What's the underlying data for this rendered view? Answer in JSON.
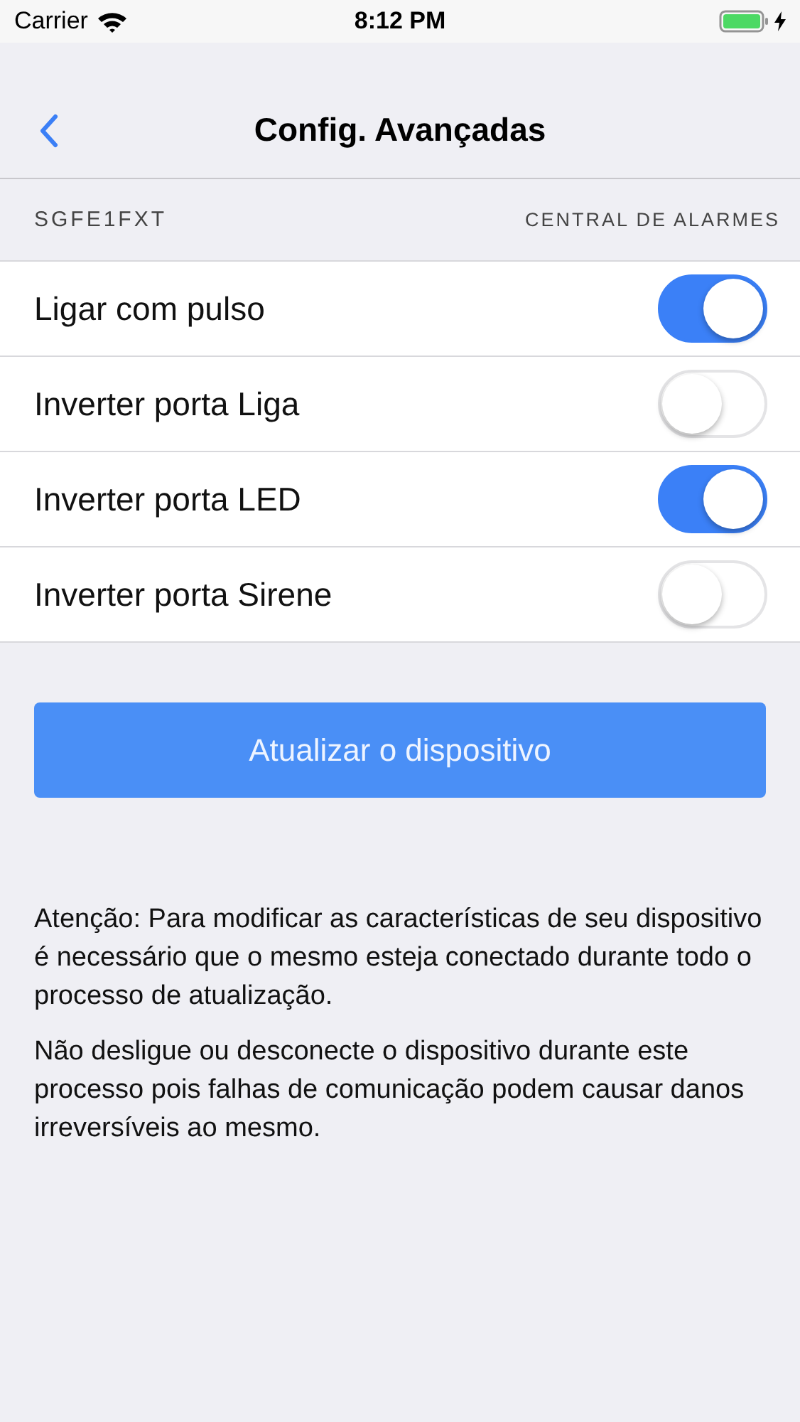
{
  "status_bar": {
    "carrier": "Carrier",
    "time": "8:12 PM",
    "battery_charging": true
  },
  "nav": {
    "title": "Config. Avançadas"
  },
  "section": {
    "left": "SGFE1FXT",
    "right": "CENTRAL DE ALARMES"
  },
  "toggles": [
    {
      "label": "Ligar com pulso",
      "on": true
    },
    {
      "label": "Inverter porta Liga",
      "on": false
    },
    {
      "label": "Inverter porta LED",
      "on": true
    },
    {
      "label": "Inverter porta Sirene",
      "on": false
    }
  ],
  "update_button": "Atualizar o dispositivo",
  "notes": [
    "Atenção: Para modificar as características de seu dispositivo é necessário que o mesmo esteja conectado durante todo o processo de atualização.",
    "Não desligue ou desconecte o dispositivo durante este processo pois falhas de comunicação podem causar danos irreversíveis ao mesmo."
  ]
}
